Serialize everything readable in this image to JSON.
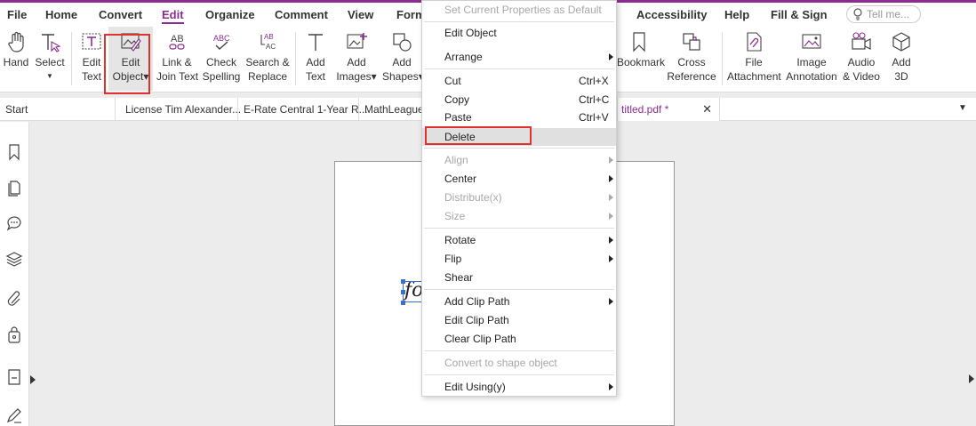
{
  "menubar": {
    "tabs": [
      "File",
      "Home",
      "Convert",
      "Edit",
      "Organize",
      "Comment",
      "View",
      "Form",
      "Accessibility",
      "Help",
      "Fill & Sign"
    ],
    "active_tab": "Edit",
    "tell_me_placeholder": "Tell me..."
  },
  "ribbon": {
    "hand": [
      "Hand"
    ],
    "select": [
      "Select"
    ],
    "edit_text": [
      "Edit",
      "Text"
    ],
    "edit_object": [
      "Edit",
      "Object▾"
    ],
    "link_join": [
      "Link &",
      "Join Text"
    ],
    "check_spelling": [
      "Check",
      "Spelling"
    ],
    "search_replace": [
      "Search &",
      "Replace"
    ],
    "add_text": [
      "Add",
      "Text"
    ],
    "add_images": [
      "Add",
      "Images▾"
    ],
    "add_shapes": [
      "Add",
      "Shapes▾"
    ],
    "bookmark": [
      "Bookmark"
    ],
    "cross_reference": [
      "Cross",
      "Reference"
    ],
    "file_attachment": [
      "File",
      "Attachment"
    ],
    "image_annotation": [
      "Image",
      "Annotation"
    ],
    "audio_video": [
      "Audio",
      "& Video"
    ],
    "add_3d": [
      "Add",
      "3D"
    ]
  },
  "doc_tabs": {
    "start": "Start",
    "tab1": "License Tim Alexander...",
    "tab2": "E-Rate Central 1-Year R...",
    "tab3": "MathLeague",
    "active": "titled.pdf *"
  },
  "page": {
    "text": "fo"
  },
  "context_menu": {
    "set_default": "Set Current Properties as Default",
    "edit_object": "Edit Object",
    "arrange": "Arrange",
    "cut": "Cut",
    "cut_sc": "Ctrl+X",
    "copy": "Copy",
    "copy_sc": "Ctrl+C",
    "paste": "Paste",
    "paste_sc": "Ctrl+V",
    "delete": "Delete",
    "align": "Align",
    "center": "Center",
    "distribute": "Distribute(x)",
    "size": "Size",
    "rotate": "Rotate",
    "flip": "Flip",
    "shear": "Shear",
    "add_clip": "Add Clip Path",
    "edit_clip": "Edit Clip Path",
    "clear_clip": "Clear Clip Path",
    "convert_shape": "Convert to shape object",
    "edit_using": "Edit Using(y)"
  },
  "colors": {
    "accent": "#8a2d8f",
    "highlight_box": "#e03030",
    "selection": "#3a6fd0"
  }
}
